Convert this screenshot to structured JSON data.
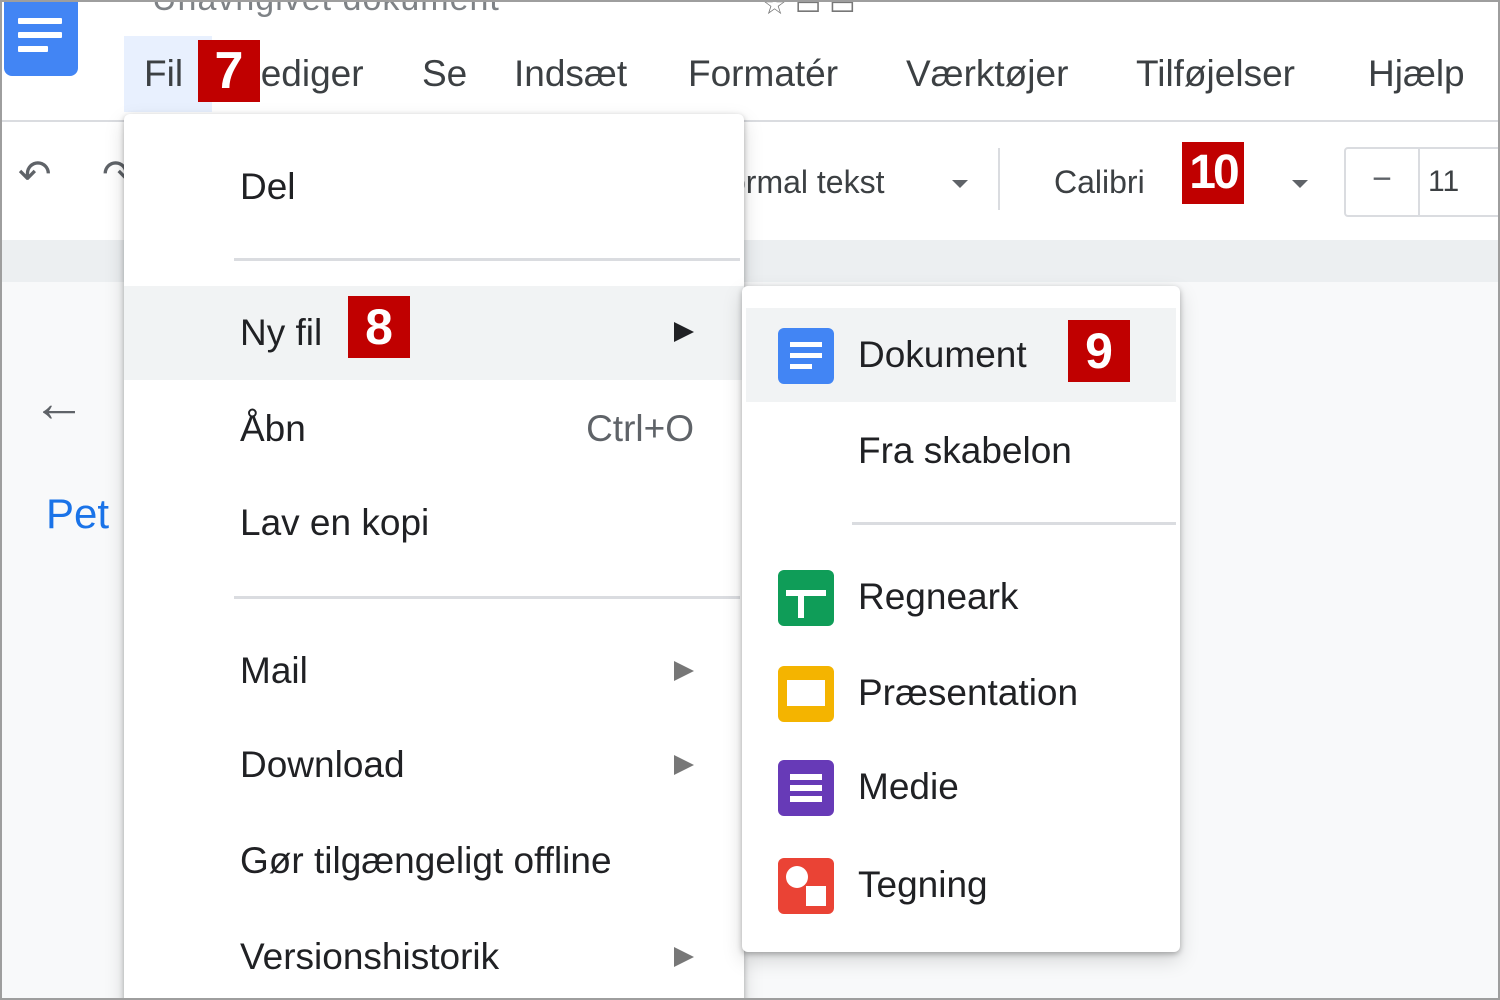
{
  "app": {
    "title": "Unavngivet dokument"
  },
  "menubar": {
    "items": [
      {
        "label": "Fil",
        "active": true
      },
      {
        "label": "Rediger"
      },
      {
        "label": "Se"
      },
      {
        "label": "Indsæt"
      },
      {
        "label": "Formatér"
      },
      {
        "label": "Værktøjer"
      },
      {
        "label": "Tilføjelser"
      },
      {
        "label": "Hjælp"
      }
    ]
  },
  "toolbar": {
    "style_select": "ormal tekst",
    "font_select": "Calibri",
    "font_size_minus": "−",
    "font_size": "11"
  },
  "sidebar": {
    "outline_text": "Pet"
  },
  "file_menu": {
    "items": [
      {
        "label": "Del"
      },
      {
        "label": "Ny fil",
        "submenu": true,
        "highlighted": true
      },
      {
        "label": "Åbn",
        "shortcut": "Ctrl+O"
      },
      {
        "label": "Lav en kopi"
      },
      {
        "label": "Mail",
        "submenu": true
      },
      {
        "label": "Download",
        "submenu": true
      },
      {
        "label": "Gør tilgængeligt offline"
      },
      {
        "label": "Versionshistorik",
        "submenu": true
      }
    ]
  },
  "new_submenu": {
    "items": [
      {
        "label": "Dokument",
        "icon": "docs-icon",
        "color": "#4285f4",
        "highlighted": true
      },
      {
        "label": "Fra skabelon"
      },
      {
        "label": "Regneark",
        "icon": "sheets-icon",
        "color": "#0f9d58"
      },
      {
        "label": "Præsentation",
        "icon": "slides-icon",
        "color": "#f4b400"
      },
      {
        "label": "Medie",
        "icon": "forms-icon",
        "color": "#673ab7"
      },
      {
        "label": "Tegning",
        "icon": "drawings-icon",
        "color": "#ea4335"
      }
    ]
  },
  "badges": {
    "b7": "7",
    "b8": "8",
    "b9": "9",
    "b10": "10"
  },
  "colors": {
    "badge": "#c00000",
    "accent": "#4285f4",
    "menu_active": "#e8f0fe",
    "hover": "#f1f3f4"
  }
}
